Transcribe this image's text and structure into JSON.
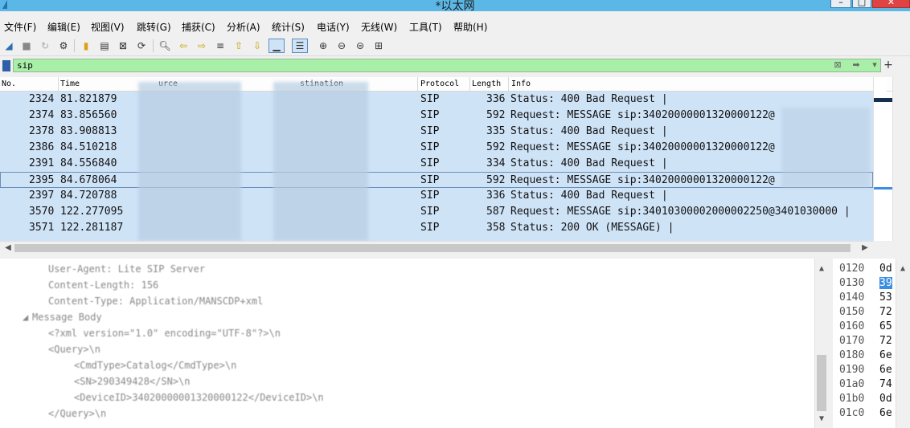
{
  "window": {
    "title": "*以太网"
  },
  "menu": [
    "文件(F)",
    "编辑(E)",
    "视图(V)",
    "跳转(G)",
    "捕获(C)",
    "分析(A)",
    "统计(S)",
    "电话(Y)",
    "无线(W)",
    "工具(T)",
    "帮助(H)"
  ],
  "filter": {
    "value": "sip"
  },
  "columns": [
    "No.",
    "Time",
    "urce",
    "stination",
    "Protocol",
    "Length",
    "Info"
  ],
  "packets": [
    {
      "no": "2324",
      "time": "81.821879",
      "protocol": "SIP",
      "length": "336",
      "info": "Status: 400 Bad Request |"
    },
    {
      "no": "2374",
      "time": "83.856560",
      "protocol": "SIP",
      "length": "592",
      "info": "Request: MESSAGE sip:34020000001320000122@"
    },
    {
      "no": "2378",
      "time": "83.908813",
      "protocol": "SIP",
      "length": "335",
      "info": "Status: 400 Bad Request |"
    },
    {
      "no": "2386",
      "time": "84.510218",
      "protocol": "SIP",
      "length": "592",
      "info": "Request: MESSAGE sip:34020000001320000122@"
    },
    {
      "no": "2391",
      "time": "84.556840",
      "protocol": "SIP",
      "length": "334",
      "info": "Status: 400 Bad Request |"
    },
    {
      "no": "2395",
      "time": "84.678064",
      "protocol": "SIP",
      "length": "592",
      "info": "Request: MESSAGE sip:34020000001320000122@"
    },
    {
      "no": "2397",
      "time": "84.720788",
      "protocol": "SIP",
      "length": "336",
      "info": "Status: 400 Bad Request |"
    },
    {
      "no": "3570",
      "time": "122.277095",
      "protocol": "SIP",
      "length": "587",
      "info": "Request: MESSAGE sip:34010300002000002250@3401030000 |"
    },
    {
      "no": "3571",
      "time": "122.281187",
      "protocol": "SIP",
      "length": "358",
      "info": "Status: 200 OK (MESSAGE) |"
    }
  ],
  "details": [
    "User-Agent: Lite SIP Server",
    "Content-Length: 156",
    "Content-Type: Application/MANSCDP+xml",
    "Message Body",
    "<?xml version=\"1.0\" encoding=\"UTF-8\"?>\\n",
    "<Query>\\n",
    "<CmdType>Catalog</CmdType>\\n",
    "<SN>290349428</SN>\\n",
    "<DeviceID>34020000001320000122</DeviceID>\\n",
    "</Query>\\n"
  ],
  "bytes": {
    "offsets": [
      "0120",
      "0130",
      "0140",
      "0150",
      "0160",
      "0170",
      "0180",
      "0190",
      "01a0",
      "01b0",
      "01c0"
    ],
    "hex": [
      "0d",
      "39",
      "53",
      "72",
      "65",
      "72",
      "6e",
      "6e",
      "74",
      "0d",
      "6e"
    ]
  }
}
